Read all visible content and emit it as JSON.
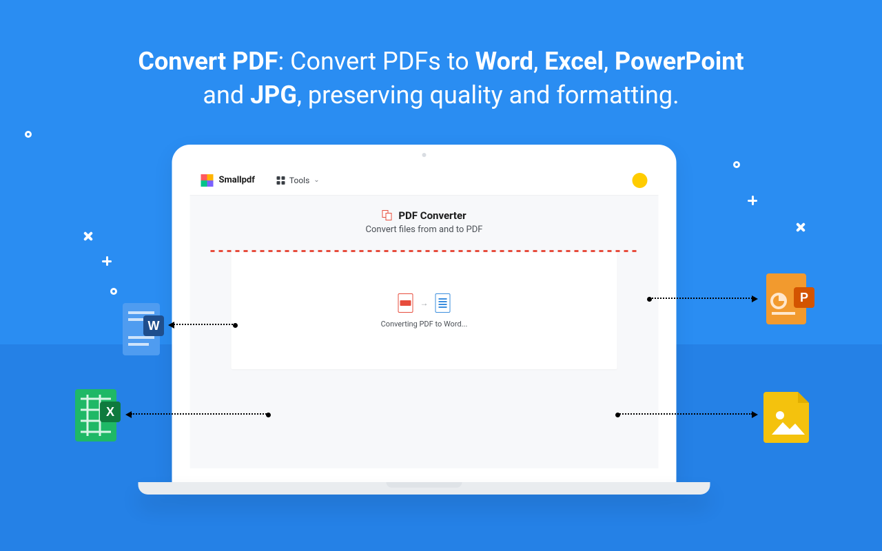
{
  "headline": {
    "lead_bold": "Convert PDF",
    "after_colon": ": Convert PDFs to ",
    "word": "Word",
    "sep1": ", ",
    "excel": "Excel",
    "sep2": ", ",
    "ppt": "PowerPoint",
    "line2_pre": "and ",
    "jpg": "JPG",
    "line2_post": ", preserving quality and formatting."
  },
  "app": {
    "brand": "Smallpdf",
    "tools_label": "Tools",
    "converter_title": "PDF Converter",
    "converter_sub": "Convert files from and to PDF",
    "status": "Converting PDF to Word..."
  }
}
